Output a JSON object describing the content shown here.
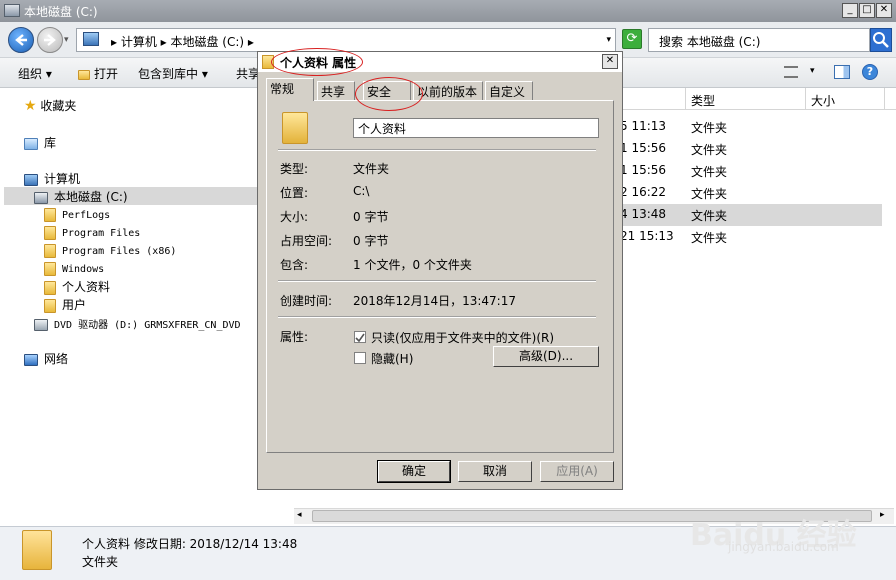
{
  "window": {
    "title": "本地磁盘 (C:)",
    "min_glyph": "_",
    "max_glyph": "□",
    "close_glyph": "✕"
  },
  "address": {
    "path": "▸ 计算机 ▸ 本地磁盘 (C:) ▸",
    "search_placeholder": "搜索 本地磁盘 (C:)"
  },
  "toolbar": {
    "organize": "组织 ▾",
    "open": "打开",
    "include_library": "包含到库中 ▾",
    "share": "共享"
  },
  "sidebar": {
    "favorites": "收藏夹",
    "libraries": "库",
    "computer": "计算机",
    "local_disk": "本地磁盘 (C:)",
    "folders": [
      "PerfLogs",
      "Program Files",
      "Program Files (x86)",
      "Windows",
      "个人资料",
      "用户"
    ],
    "dvd": "DVD 驱动器 (D:) GRMSXFRER_CN_DVD",
    "network": "网络"
  },
  "list": {
    "headers": {
      "type": "类型",
      "size": "大小"
    },
    "rows": [
      {
        "date": "5 11:13",
        "type": "文件夹"
      },
      {
        "date": "1 15:56",
        "type": "文件夹"
      },
      {
        "date": "1 15:56",
        "type": "文件夹"
      },
      {
        "date": "2 16:22",
        "type": "文件夹"
      },
      {
        "date": "4 13:48",
        "type": "文件夹"
      },
      {
        "date": "21 15:13",
        "type": "文件夹"
      }
    ]
  },
  "status": {
    "line1": "个人资料  修改日期: 2018/12/14 13:48",
    "line2": "文件夹"
  },
  "watermark": {
    "main": "Baidu 经验",
    "sub": "jingyan.baidu.com"
  },
  "dialog": {
    "title": "个人资料 属性",
    "close_glyph": "✕",
    "tabs": [
      "常规",
      "共享",
      "安全",
      "以前的版本",
      "自定义"
    ],
    "name_value": "个人资料",
    "fields": [
      {
        "label": "类型:",
        "value": "文件夹"
      },
      {
        "label": "位置:",
        "value": "C:\\"
      },
      {
        "label": "大小:",
        "value": "0 字节"
      },
      {
        "label": "占用空间:",
        "value": "0 字节"
      },
      {
        "label": "包含:",
        "value": "1 个文件，0 个文件夹"
      }
    ],
    "created_label": "创建时间:",
    "created_value": "2018年12月14日，13:47:17",
    "attributes_label": "属性:",
    "readonly_label": "只读(仅应用于文件夹中的文件)(R)",
    "readonly_checked": true,
    "hidden_label": "隐藏(H)",
    "hidden_checked": false,
    "advanced_button": "高级(D)...",
    "ok_button": "确定",
    "cancel_button": "取消",
    "apply_button": "应用(A)"
  }
}
